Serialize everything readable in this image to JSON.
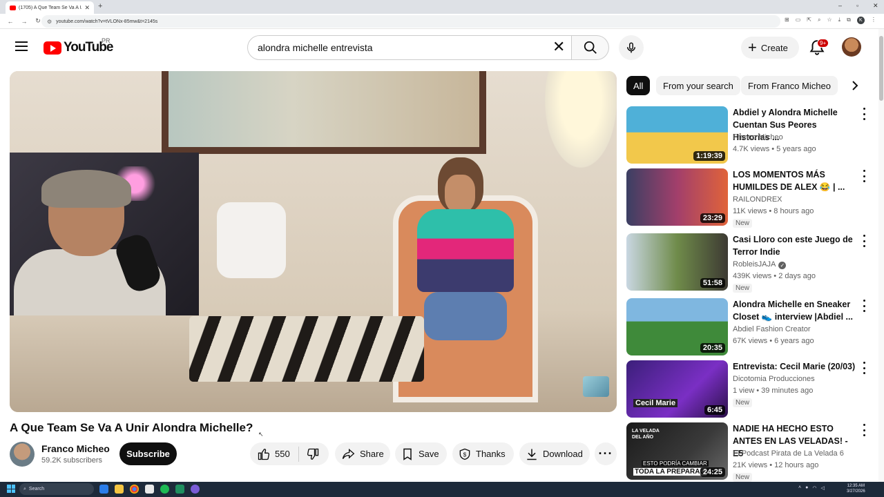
{
  "browser": {
    "tab_title": "(1705) A Que Team Se Va A Unir",
    "url": "youtube.com/watch?v=tVLONx-85mw&t=2145s"
  },
  "header": {
    "logo_text": "YouTube",
    "region": "PR",
    "search_value": "alondra michelle entrevista",
    "create_label": "Create",
    "notification_count": "9+"
  },
  "video": {
    "title": "A Que Team Se Va A Unir Alondra Michelle?",
    "channel": "Franco Micheo",
    "subscribers": "59.2K subscribers",
    "subscribe_label": "Subscribe",
    "likes": "550",
    "share_label": "Share",
    "save_label": "Save",
    "thanks_label": "Thanks",
    "download_label": "Download"
  },
  "chips": [
    "All",
    "From your search",
    "From Franco Micheo"
  ],
  "recommendations": [
    {
      "title": "Abdiel y Alondra Michelle Cuentan Sus Peores Historias ...",
      "channel": "Franco Micheo",
      "meta": "4.7K views • 5 years ago",
      "duration": "1:19:39",
      "new": "",
      "verified": false
    },
    {
      "title": "LOS MOMENTOS MÁS HUMILDES DE ALEX 😂 | ...",
      "channel": "RAILONDREX",
      "meta": "11K views • 8 hours ago",
      "duration": "23:29",
      "new": "New",
      "verified": false
    },
    {
      "title": "Casi Lloro con este Juego de Terror Indie",
      "channel": "RobleisJAJA",
      "meta": "439K views • 2 days ago",
      "duration": "51:58",
      "new": "New",
      "verified": true
    },
    {
      "title": "Alondra Michelle en Sneaker Closet 👟 interview |Abdiel ...",
      "channel": "Abdiel Fashion Creator",
      "meta": "67K views • 6 years ago",
      "duration": "20:35",
      "new": "",
      "verified": false
    },
    {
      "title": "Entrevista: Cecil Marie (20/03)",
      "channel": "Dicotomia Producciones",
      "meta": "1 view • 39 minutes ago",
      "duration": "6:45",
      "new": "New",
      "verified": false
    },
    {
      "title": "NADIE HA HECHO ESTO ANTES EN LAS VELADAS! - E5",
      "channel": "El Podcast Pirata de La Velada 6",
      "meta": "21K views • 12 hours ago",
      "duration": "24:25",
      "new": "New",
      "verified": false
    }
  ],
  "thumb_text": {
    "cecil": "Cecil Marie",
    "velada_top": "LA VELADA DEL AÑO",
    "velada_line1": "ESTO PODRÍA CAMBIAR",
    "velada_line2": "TODA LA PREPARAC"
  },
  "taskbar": {
    "search_label": "Search",
    "time": "12:35 AM",
    "date": "3/27/2026"
  }
}
